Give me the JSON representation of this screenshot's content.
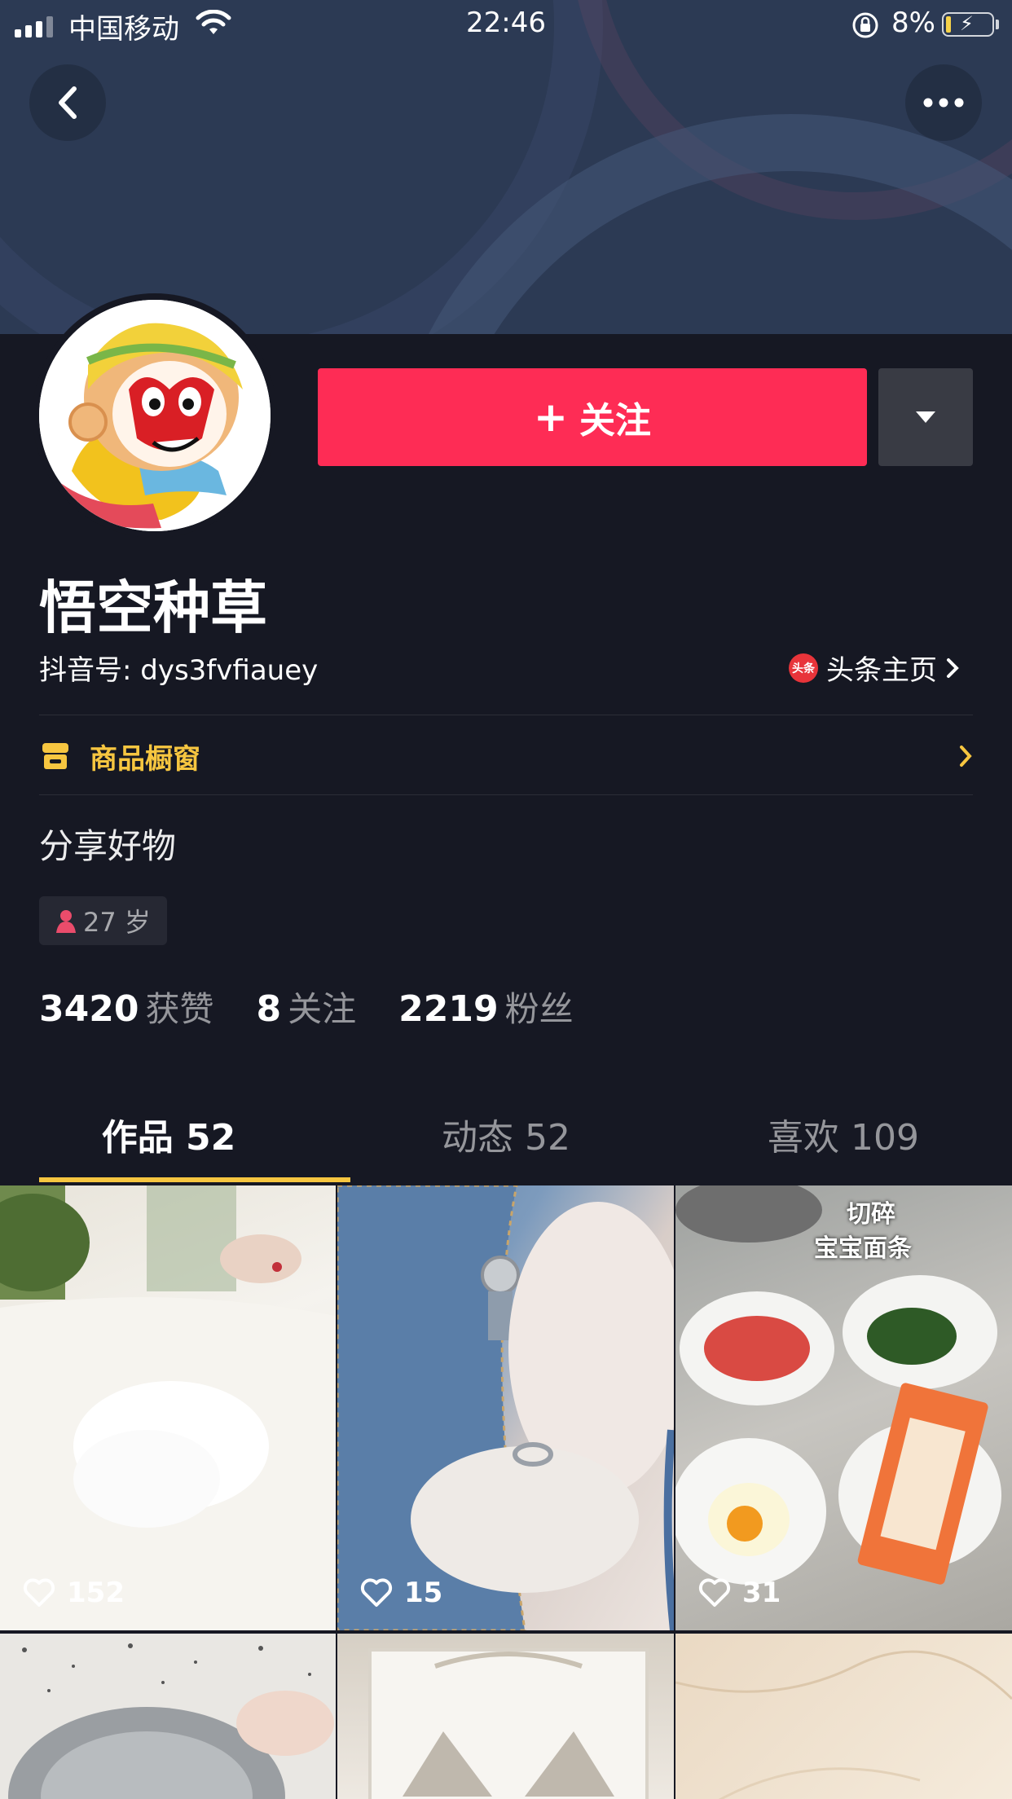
{
  "status_bar": {
    "carrier": "中国移动",
    "time": "22:46",
    "battery": "8%"
  },
  "profile": {
    "follow_label": "关注",
    "name": "悟空种草",
    "douyin_id": "抖音号: dys3fvfiauey",
    "toutiao_badge": "头条",
    "toutiao_link": "头条主页",
    "shop_label": "商品橱窗",
    "bio": "分享好物",
    "age": "27 岁"
  },
  "stats": [
    {
      "num": "3420",
      "label": "获赞"
    },
    {
      "num": "8",
      "label": "关注"
    },
    {
      "num": "2219",
      "label": "粉丝"
    }
  ],
  "tabs": [
    {
      "label": "作品 52",
      "active": true
    },
    {
      "label": "动态 52",
      "active": false
    },
    {
      "label": "喜欢 109",
      "active": false
    }
  ],
  "videos": [
    {
      "likes": "152"
    },
    {
      "likes": "15"
    },
    {
      "likes": "31",
      "overlay_text": [
        "切碎",
        "宝宝面条"
      ]
    }
  ],
  "colors": {
    "background": "#161823",
    "follow_button": "#fe2c55",
    "accent_yellow": "#f7c640"
  }
}
